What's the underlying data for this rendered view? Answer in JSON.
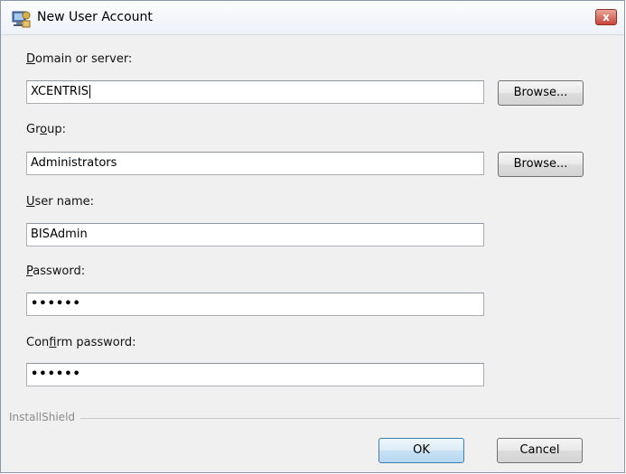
{
  "window": {
    "title": "New User Account",
    "close_glyph": "x",
    "icon": "installshield-computer-icon"
  },
  "form": {
    "domain": {
      "label_prefix": "",
      "label_accel": "D",
      "label_rest": "omain or server:",
      "value": "XCENTRIS",
      "browse_label": "Browse..."
    },
    "group": {
      "label_prefix": "Gr",
      "label_accel": "o",
      "label_rest": "up:",
      "value": "Administrators",
      "browse_label": "Browse..."
    },
    "username": {
      "label_prefix": "",
      "label_accel": "U",
      "label_rest": "ser name:",
      "value": "BISAdmin"
    },
    "password": {
      "label_prefix": "",
      "label_accel": "P",
      "label_rest": "assword:",
      "value": "••••••"
    },
    "confirm": {
      "label_prefix": "Con",
      "label_accel": "f",
      "label_rest": "irm password:",
      "value": "••••••"
    }
  },
  "footer": {
    "brand": "InstallShield",
    "ok_label": "OK",
    "cancel_label": "Cancel"
  },
  "colors": {
    "dialog_bg": "#f0f0f0",
    "close_red": "#c9453a",
    "default_button_border": "#3c7fb1"
  }
}
